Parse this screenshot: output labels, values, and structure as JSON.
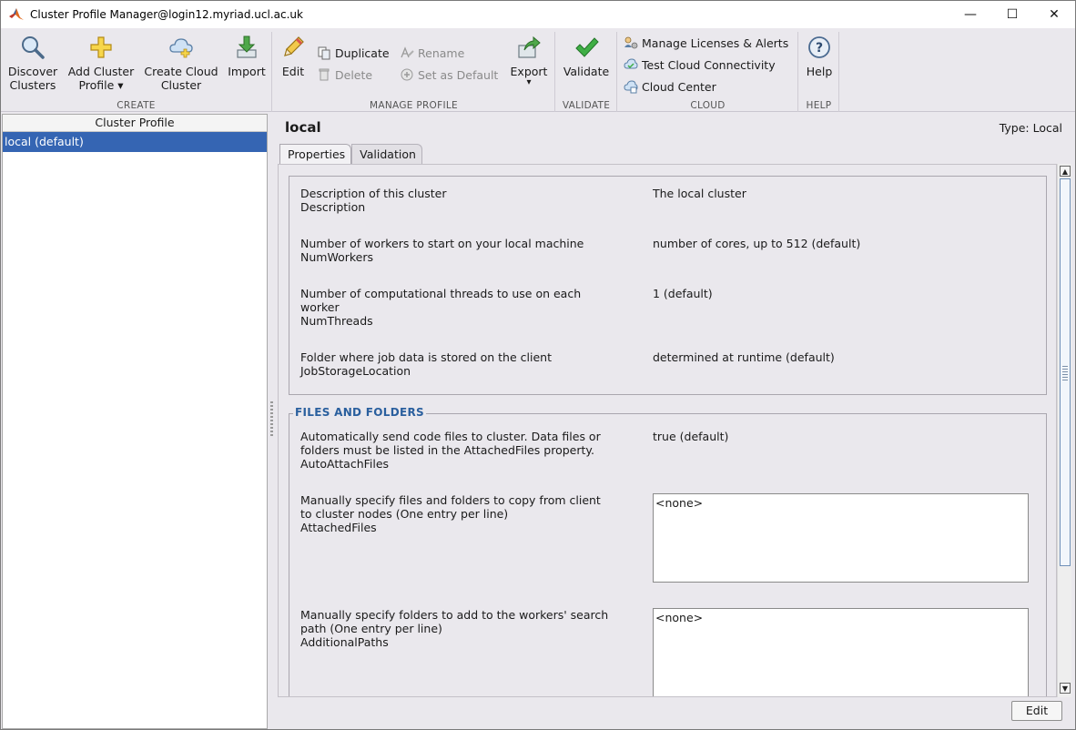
{
  "window": {
    "title": "Cluster Profile Manager@login12.myriad.ucl.ac.uk",
    "controls": {
      "minimize": "—",
      "maximize": "☐",
      "close": "✕"
    }
  },
  "ribbon": {
    "create": {
      "label": "CREATE",
      "discover": {
        "line1": "Discover",
        "line2": "Clusters"
      },
      "add": {
        "line1": "Add Cluster",
        "line2": "Profile ▾"
      },
      "create_cloud": {
        "line1": "Create Cloud",
        "line2": "Cluster"
      },
      "import": {
        "line1": "Import"
      }
    },
    "manage": {
      "label": "MANAGE PROFILE",
      "edit": "Edit",
      "duplicate": "Duplicate",
      "delete": "Delete",
      "rename": "Rename",
      "set_default": "Set as Default",
      "export": "Export",
      "export_arrow": "▾"
    },
    "validate": {
      "label": "VALIDATE",
      "validate": "Validate"
    },
    "cloud": {
      "label": "CLOUD",
      "manage_licenses": "Manage Licenses & Alerts",
      "test_connectivity": "Test Cloud Connectivity",
      "cloud_center": "Cloud Center"
    },
    "help": {
      "label": "HELP",
      "help": "Help"
    }
  },
  "left_panel": {
    "header": "Cluster Profile",
    "items": [
      {
        "label": "local (default)",
        "selected": true
      }
    ]
  },
  "profile": {
    "name": "local",
    "type_label": "Type: Local",
    "tabs": [
      {
        "label": "Properties",
        "active": true
      },
      {
        "label": "Validation",
        "active": false
      }
    ]
  },
  "properties": [
    {
      "desc": "Description of this cluster",
      "key": "Description",
      "value": "The local cluster"
    },
    {
      "desc": "Number of workers to start on your local machine",
      "key": "NumWorkers",
      "value": "number of cores, up to 512 (default)"
    },
    {
      "desc1": "Number of computational threads to use on each",
      "desc2": "worker",
      "key": "NumThreads",
      "value": "1 (default)"
    },
    {
      "desc": "Folder where job data is stored on the client",
      "key": "JobStorageLocation",
      "value": "determined at runtime (default)"
    }
  ],
  "files_section": {
    "title": "FILES AND FOLDERS",
    "items": [
      {
        "desc1": "Automatically send code files to cluster. Data files or",
        "desc2": "folders must be listed in the AttachedFiles property.",
        "key": "AutoAttachFiles",
        "value": "true (default)"
      },
      {
        "desc1": "Manually specify files and folders to copy from client",
        "desc2": "to cluster nodes (One entry per line)",
        "key": "AttachedFiles",
        "value": "<none>"
      },
      {
        "desc1": "Manually specify folders to add to the workers' search",
        "desc2": "path (One entry per line)",
        "key": "AdditionalPaths",
        "value": "<none>"
      }
    ]
  },
  "footer": {
    "edit": "Edit"
  },
  "colors": {
    "selection": "#3565b3",
    "section_title": "#2a5f9e",
    "background": "#eae8ed"
  }
}
